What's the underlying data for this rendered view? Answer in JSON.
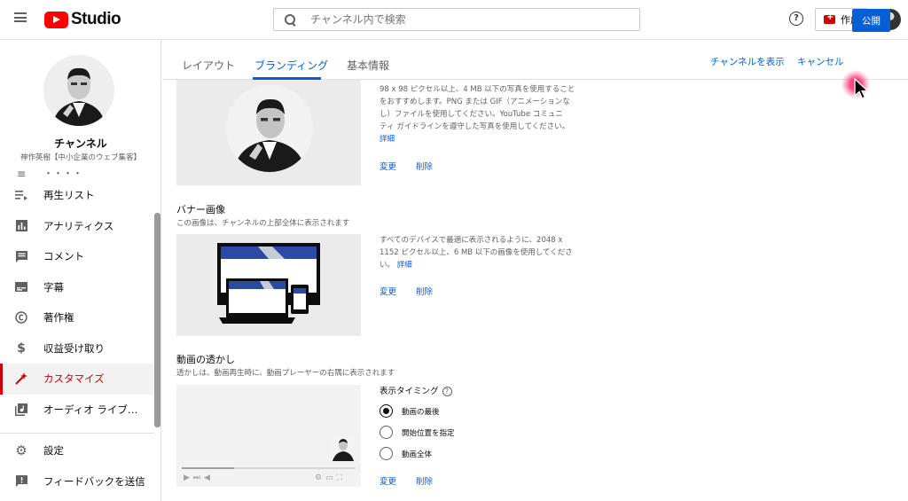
{
  "app": {
    "logo_text": "Studio"
  },
  "search": {
    "placeholder": "チャンネル内で検索"
  },
  "header": {
    "help": "?",
    "create_label": "作成"
  },
  "channel": {
    "title": "チャンネル",
    "subtitle": "神作英樹【中小企業のウェブ集客】"
  },
  "sidebar": {
    "partial_item": "・・・・",
    "items": [
      {
        "label": "再生リスト",
        "icon": "playlist-icon"
      },
      {
        "label": "アナリティクス",
        "icon": "analytics-icon"
      },
      {
        "label": "コメント",
        "icon": "comment-icon"
      },
      {
        "label": "字幕",
        "icon": "subtitles-icon"
      },
      {
        "label": "著作権",
        "icon": "copyright-icon"
      },
      {
        "label": "収益受け取り",
        "icon": "dollar-icon"
      },
      {
        "label": "カスタマイズ",
        "icon": "wand-icon"
      },
      {
        "label": "オーディオ ライブ…",
        "icon": "audio-library-icon"
      }
    ],
    "bottom_items": [
      {
        "label": "設定",
        "icon": "gear-icon"
      },
      {
        "label": "フィードバックを送信",
        "icon": "feedback-icon"
      }
    ]
  },
  "tabs": [
    {
      "label": "レイアウト"
    },
    {
      "label": "ブランディング"
    },
    {
      "label": "基本情報"
    }
  ],
  "actions": {
    "view_channel": "チャンネルを表示",
    "cancel": "キャンセル",
    "publish": "公開"
  },
  "profile_section": {
    "desc_lines": [
      "98 x 98 ピクセル以上、4 MB 以下の写真を使用すること",
      "をおすすめします。PNG または GIF（アニメーションな",
      "し）ファイルを使用してください。YouTube コミュニ",
      "ティ ガイドラインを遵守した写真を使用してください。"
    ],
    "detail": "詳細",
    "change": "変更",
    "delete": "削除"
  },
  "banner_section": {
    "title": "バナー画像",
    "subtitle": "この画像は、チャンネルの上部全体に表示されます",
    "desc_lines": [
      "すべてのデバイスで最適に表示されるように、2048 x",
      "1152 ピクセル以上、6 MB 以下の画像を使用してくださ"
    ],
    "desc_tail": "い。",
    "detail": "詳細",
    "change": "変更",
    "delete": "削除"
  },
  "watermark_section": {
    "title": "動画の透かし",
    "subtitle": "透かしは、動画再生時に、動画プレーヤーの右隅に表示されます",
    "timing_label": "表示タイミング",
    "options": [
      "動画の最後",
      "開始位置を指定",
      "動画全体"
    ],
    "selected_index": 0,
    "change": "変更",
    "delete": "削除"
  },
  "colors": {
    "accent_blue": "#065fd4",
    "active_red": "#cc0000",
    "brand_red": "#ff0000"
  }
}
